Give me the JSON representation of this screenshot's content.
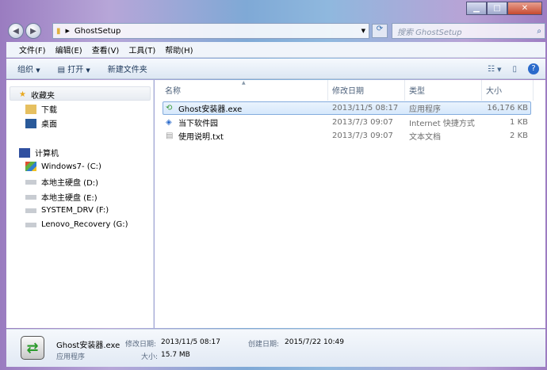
{
  "address": {
    "folder": "GhostSetup",
    "search_placeholder": "搜索 GhostSetup"
  },
  "menu": [
    "文件(F)",
    "编辑(E)",
    "查看(V)",
    "工具(T)",
    "帮助(H)"
  ],
  "toolbar": {
    "organize": "组织",
    "open": "打开",
    "new_folder": "新建文件夹"
  },
  "nav": {
    "favorites": "收藏夹",
    "fav_items": [
      "下载",
      "桌面"
    ],
    "computer": "计算机",
    "drives": [
      "Windows7- (C:)",
      "本地主硬盘 (D:)",
      "本地主硬盘 (E:)",
      "SYSTEM_DRV (F:)",
      "Lenovo_Recovery (G:)"
    ]
  },
  "columns": {
    "name": "名称",
    "date": "修改日期",
    "type": "类型",
    "size": "大小"
  },
  "files": [
    {
      "name": "Ghost安装器.exe",
      "date": "2013/11/5 08:17",
      "type": "应用程序",
      "size": "16,176 KB"
    },
    {
      "name": "当下软件园",
      "date": "2013/7/3 09:07",
      "type": "Internet 快捷方式",
      "size": "1 KB"
    },
    {
      "name": "使用说明.txt",
      "date": "2013/7/3 09:07",
      "type": "文本文档",
      "size": "2 KB"
    }
  ],
  "details": {
    "name": "Ghost安装器.exe",
    "type": "应用程序",
    "modified_label": "修改日期:",
    "modified": "2013/11/5 08:17",
    "size_label": "大小:",
    "size": "15.7 MB",
    "created_label": "创建日期:",
    "created": "2015/7/22 10:49"
  }
}
